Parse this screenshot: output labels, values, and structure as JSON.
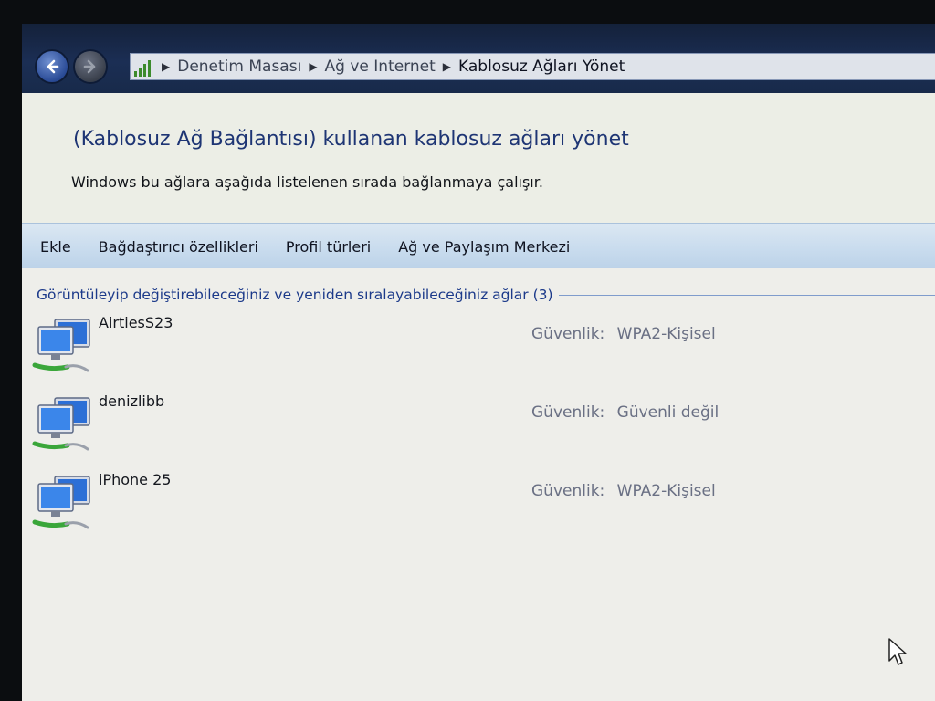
{
  "breadcrumb": {
    "items": [
      "Denetim Masası",
      "Ağ ve Internet",
      "Kablosuz Ağları Yönet"
    ]
  },
  "header": {
    "title": "(Kablosuz Ağ Bağlantısı) kullanan kablosuz ağları yönet",
    "subtitle": "Windows bu ağlara aşağıda listelenen sırada bağlanmaya çalışır."
  },
  "toolbar": {
    "add_label": "Ekle",
    "adapter_props_label": "Bağdaştırıcı özellikleri",
    "profile_types_label": "Profil türleri",
    "network_center_label": "Ağ ve Paylaşım Merkezi"
  },
  "group": {
    "title": "Görüntüleyip değiştirebileceğiniz ve yeniden sıralayabileceğiniz ağlar (3)"
  },
  "networks": [
    {
      "name": "AirtiesS23",
      "security_label": "Güvenlik:",
      "security_value": "WPA2-Kişisel"
    },
    {
      "name": "denizlibb",
      "security_label": "Güvenlik:",
      "security_value": "Güvenli değil"
    },
    {
      "name": "iPhone 25",
      "security_label": "Güvenlik:",
      "security_value": "WPA2-Kişisel"
    }
  ],
  "icons": {
    "back": "back-arrow-icon",
    "forward": "forward-arrow-icon",
    "address": "network-signal-icon",
    "network": "wireless-network-computer-icon",
    "cursor": "mouse-pointer-icon"
  },
  "colors": {
    "title_blue": "#1e3574",
    "group_blue": "#1c3a8a",
    "toolbar_blue": "#c9dcee",
    "security_gray": "#6a7084"
  }
}
